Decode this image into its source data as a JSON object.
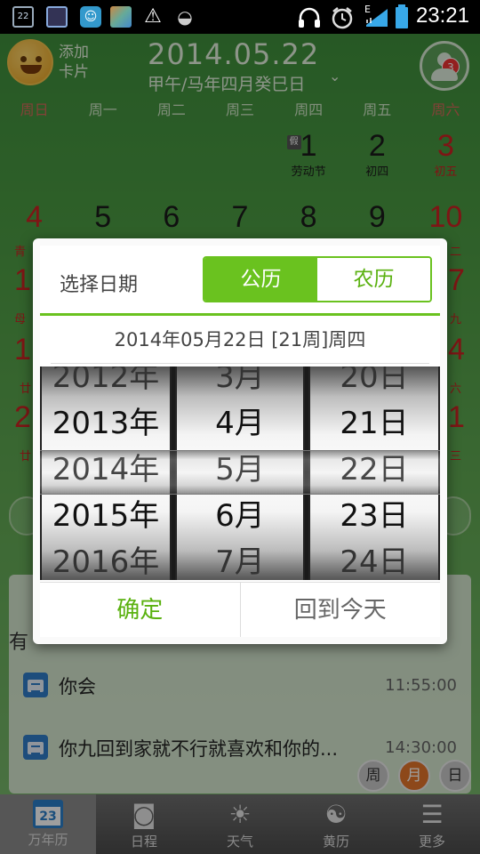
{
  "status_bar": {
    "time": "23:21",
    "left_icons": [
      "calendar-22-icon",
      "news-icon",
      "app-icon",
      "photo-icon",
      "warning-icon",
      "android-icon"
    ],
    "calendar_icon_text": "22",
    "right_icons": [
      "headphones-icon",
      "alarm-icon",
      "signal-icon",
      "battery-icon"
    ],
    "network_label": "E"
  },
  "header": {
    "add_card_label": "添加卡片",
    "date": "2014.05.22",
    "lunar": "甲午/马年四月癸巳日",
    "notification_count": "3"
  },
  "weekdays": [
    "周日",
    "周一",
    "周二",
    "周三",
    "周四",
    "周五",
    "周六"
  ],
  "calendar": {
    "row1": [
      {
        "num": "",
        "sub": ""
      },
      {
        "num": "",
        "sub": ""
      },
      {
        "num": "",
        "sub": ""
      },
      {
        "num": "",
        "sub": ""
      },
      {
        "num": "1",
        "sub": "劳动节",
        "tag": "假"
      },
      {
        "num": "2",
        "sub": "初四"
      },
      {
        "num": "3",
        "sub": "初五"
      }
    ],
    "row2": [
      "4",
      "5",
      "6",
      "7",
      "8",
      "9",
      "10"
    ],
    "partial_left": [
      "青",
      "1",
      "母",
      "1",
      "廿",
      "2",
      "廿"
    ],
    "partial_right": [
      "二",
      "7",
      "九",
      "4",
      "六",
      "1",
      "三"
    ]
  },
  "dialog": {
    "title": "选择日期",
    "tab_solar": "公历",
    "tab_lunar": "农历",
    "selected_date": "2014年05月22日 [21周]周四",
    "years": [
      "2012年",
      "2013年",
      "2014年",
      "2015年",
      "2016年"
    ],
    "months": [
      "3月",
      "4月",
      "5月",
      "6月",
      "7月"
    ],
    "days": [
      "20日",
      "21日",
      "22日",
      "23日",
      "24日"
    ],
    "ok_label": "确定",
    "today_label": "回到今天"
  },
  "events": {
    "section_label": "有",
    "items": [
      {
        "title": "你会",
        "time": "11:55:00"
      },
      {
        "title": "你九回到家就不行就喜欢和你的...",
        "time": "14:30:00"
      }
    ]
  },
  "view_buttons": [
    "周",
    "月",
    "日"
  ],
  "bottom_nav": [
    {
      "label": "万年历",
      "icon": "calendar-icon",
      "icon_text": "23"
    },
    {
      "label": "日程",
      "icon": "camera-icon"
    },
    {
      "label": "天气",
      "icon": "sun-icon"
    },
    {
      "label": "黄历",
      "icon": "yin-yang-icon"
    },
    {
      "label": "更多",
      "icon": "more-icon"
    }
  ],
  "colors": {
    "accent_green": "#6ac21f",
    "holiday_red": "#c22",
    "active_view": "#e4742b",
    "nav_active_blue": "#2b7fc9"
  }
}
